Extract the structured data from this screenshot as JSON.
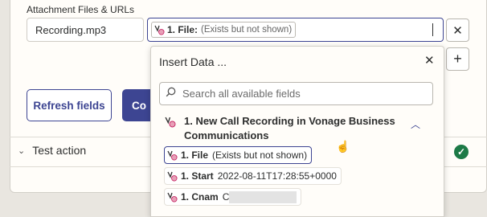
{
  "section_label": "Attachment Files & URLs",
  "name_field_value": "Recording.mp3",
  "file_chip": {
    "label": "1. File:",
    "sub": "(Exists but not shown)"
  },
  "remove_symbol": "✕",
  "add_symbol": "+",
  "buttons": {
    "refresh": "Refresh fields",
    "continue": "Co"
  },
  "test_action": {
    "chevron": "⌄",
    "label": "Test action",
    "status_symbol": "✓"
  },
  "insert_data": {
    "title": "Insert Data ...",
    "close_symbol": "✕",
    "search_placeholder": "Search all available fields",
    "group": {
      "title": "1. New Call Recording in Vonage Business Communications",
      "collapse_symbol": "︿"
    },
    "fields": [
      {
        "label": "1. File",
        "value": "(Exists but not shown)"
      },
      {
        "label": "1. Start",
        "value": "2022-08-11T17:28:55+0000"
      },
      {
        "label": "1. Cnam",
        "value": "C"
      }
    ]
  },
  "colors": {
    "accent": "#3d4592",
    "success": "#1d7a47"
  },
  "icons": {
    "app": "vonage-logo-icon",
    "search": "search-icon",
    "pointer": "hand-pointer-icon"
  }
}
